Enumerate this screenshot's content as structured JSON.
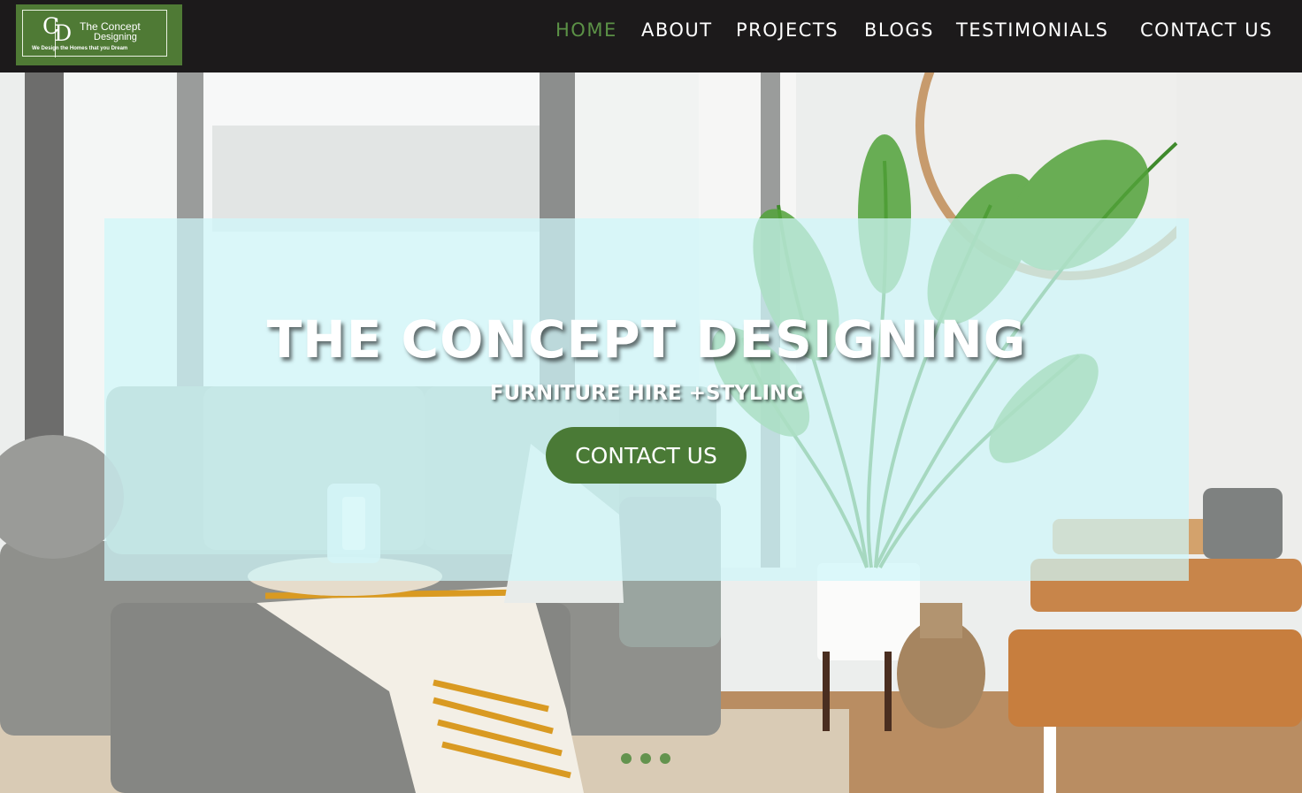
{
  "logo": {
    "monogram_c": "C",
    "monogram_d": "D",
    "name_line1": "The Concept",
    "name_line2": "Designing",
    "tagline": "We Design the Homes that you Dream",
    "bg_color": "#4f7a35"
  },
  "nav": {
    "items": [
      {
        "label": "HOME",
        "active": true
      },
      {
        "label": "ABOUT",
        "active": false
      },
      {
        "label": "PROJECTS",
        "active": false
      },
      {
        "label": "BLOGS",
        "active": false
      },
      {
        "label": "TESTIMONIALS",
        "active": false
      },
      {
        "label": "CONTACT US",
        "active": false
      }
    ],
    "active_color": "#5b9146",
    "text_color": "#ffffff",
    "bg_color": "#1c1a1b"
  },
  "hero": {
    "title": "THE CONCEPT DESIGNING",
    "subtitle": "FURNITURE HIRE +STYLING",
    "cta_label": "CONTACT US",
    "cta_color": "#4a7a36",
    "overlay_color": "#cff6f9",
    "slider_dots": 3,
    "background_image": "living-room-photo"
  }
}
